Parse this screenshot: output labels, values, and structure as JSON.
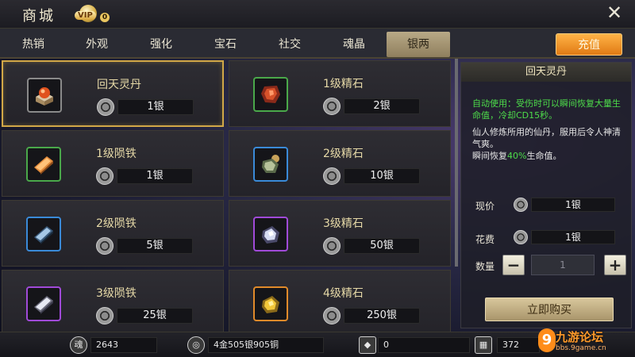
{
  "header": {
    "title": "商城",
    "vip_text": "VIP",
    "vip_level": "0"
  },
  "tabs": [
    "热销",
    "外观",
    "强化",
    "宝石",
    "社交",
    "魂晶",
    "银两"
  ],
  "active_tab_index": 6,
  "recharge_label": "充值",
  "items": [
    {
      "name": "回天灵丹",
      "price": "1银",
      "selected": true,
      "icon": "pill-box-icon"
    },
    {
      "name": "1级精石",
      "price": "2银",
      "icon": "red-ore-icon"
    },
    {
      "name": "1级陨铁",
      "price": "1银",
      "icon": "orange-ingot-icon"
    },
    {
      "name": "2级精石",
      "price": "10银",
      "icon": "green-ore-icon"
    },
    {
      "name": "2级陨铁",
      "price": "5银",
      "icon": "blue-ingot-icon"
    },
    {
      "name": "3级精石",
      "price": "50银",
      "icon": "purple-ore-icon"
    },
    {
      "name": "3级陨铁",
      "price": "25银",
      "icon": "silver-ingot-icon"
    },
    {
      "name": "4级精石",
      "price": "250银",
      "icon": "gold-ore-icon"
    }
  ],
  "detail": {
    "title": "回天灵丹",
    "auto_use": "自动使用：受伤时可以瞬间恢复大量生命值，冷却CD15秒。",
    "desc_line1": "仙人修炼所用的仙丹，服用后令人神清气爽。",
    "desc_line2_pre": "瞬间恢复",
    "desc_line2_pct": "40%",
    "desc_line2_post": "生命值。",
    "current_price_label": "现价",
    "current_price": "1银",
    "cost_label": "花费",
    "cost": "1银",
    "quantity_label": "数量",
    "quantity": "1",
    "buy_label": "立即购买"
  },
  "resources": {
    "soul_icon_char": "魂",
    "soul": "2643",
    "money": "4金505银905铜",
    "diamond": "0",
    "other": "372"
  },
  "watermark": {
    "nine": "9",
    "name": "九游论坛",
    "url": "bbs.9game.cn"
  },
  "colors": {
    "accent_gold": "#d1a747",
    "recharge_orange": "#f0901e",
    "highlight_green": "#4ddc4a"
  }
}
